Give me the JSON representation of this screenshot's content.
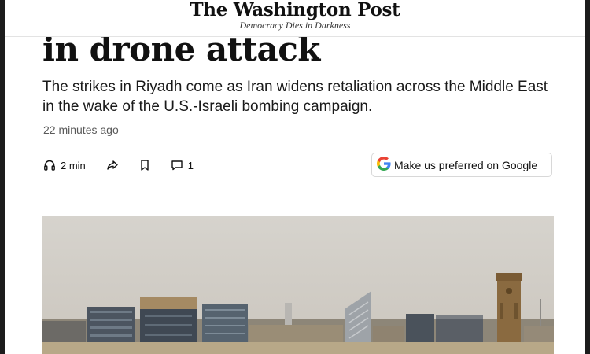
{
  "masthead": {
    "name": "The Washington Post",
    "tagline": "Democracy Dies in Darkness"
  },
  "article": {
    "headline_visible": "in drone attack",
    "dek": "The strikes in Riyadh come as Iran widens retaliation across the Middle East in the wake of the U.S.-Israeli bombing campaign.",
    "timestamp": "22 minutes ago"
  },
  "actions": {
    "listen_label": "2 min",
    "comments_count": "1",
    "icons": [
      "headphones-icon",
      "share-icon",
      "bookmark-icon",
      "comment-icon"
    ]
  },
  "google_button": {
    "label": "Make us preferred on Google",
    "icon": "google-g-icon"
  },
  "photo": {
    "subject": "city-skyline-photo"
  },
  "colors": {
    "frame": "#1c1c1c",
    "text": "#111111",
    "muted": "#5a5a5a",
    "sky": "#d2cec7",
    "google_blue": "#4285F4",
    "google_red": "#EA4335",
    "google_yellow": "#FBBC05",
    "google_green": "#34A853"
  }
}
